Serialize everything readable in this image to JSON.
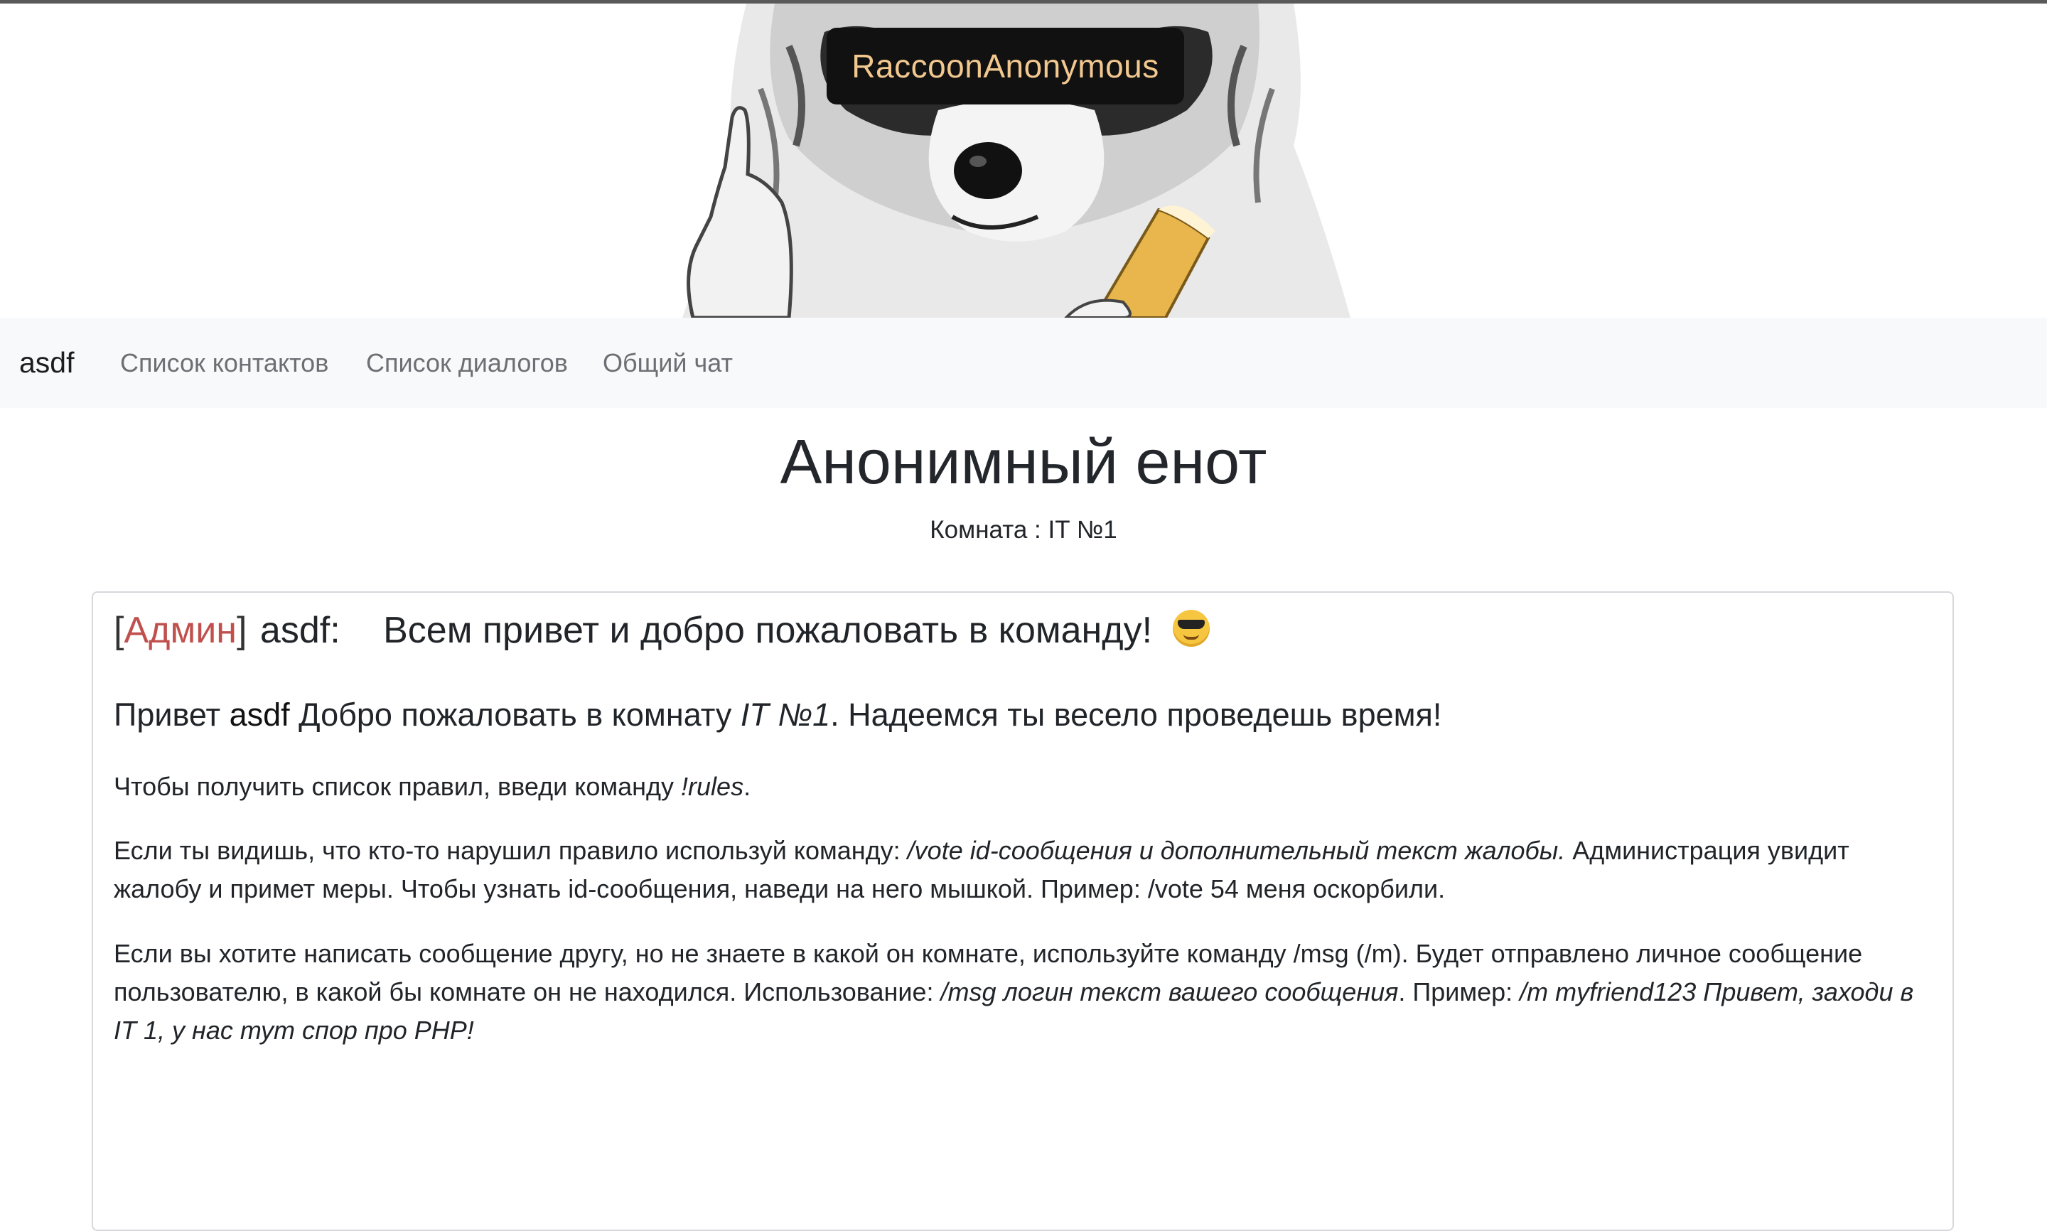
{
  "banner": {
    "brand": "RaccoonAnonymous"
  },
  "navbar": {
    "brand": "asdf",
    "links": [
      "Список контактов",
      "Список диалогов",
      "Общий чат"
    ]
  },
  "page": {
    "title": "Анонимный енот",
    "room": "Комната : IT №1"
  },
  "message": {
    "role": "Админ",
    "author": "asdf:",
    "text": "Всем привет и добро пожаловать в команду!",
    "emoji": "smiling-face-with-sunglasses",
    "greeting": {
      "hello": "Привет ",
      "name": "asdf",
      "welcome": " Добро пожаловать в комнату ",
      "room": "IT №1",
      "rest": ". Надеемся ты весело проведешь время!"
    },
    "rules": {
      "pre": "Чтобы получить список правил, введи команду ",
      "cmd": "!rules",
      "post": "."
    },
    "vote": {
      "pre": "Если ты видишь, что кто-то нарушил правило используй команду: ",
      "cmd": "/vote id-сообщения и дополнительный текст жалобы.",
      "post": " Администрация увидит жалобу и примет меры. Чтобы узнать id-сообщения, наведи на него мышкой. Пример: /vote 54 меня оскорбили."
    },
    "msg": {
      "pre": "Если вы хотите написать сообщение другу, но не знаете в какой он комнате, используйте команду /msg (/m). Будет отправлено личное сообщение пользователю, в какой бы комнате он не находился. Использование: ",
      "usage": "/msg логин текст вашего сообщения",
      "mid": ". Пример: ",
      "example": "/m myfriend123 Привет, заходи в IT 1, у нас тут спор про PHP!"
    }
  },
  "colors": {
    "admin": "#c0504d",
    "brand_text": "#f2c88f",
    "navbar_bg": "#f8f9fa"
  }
}
